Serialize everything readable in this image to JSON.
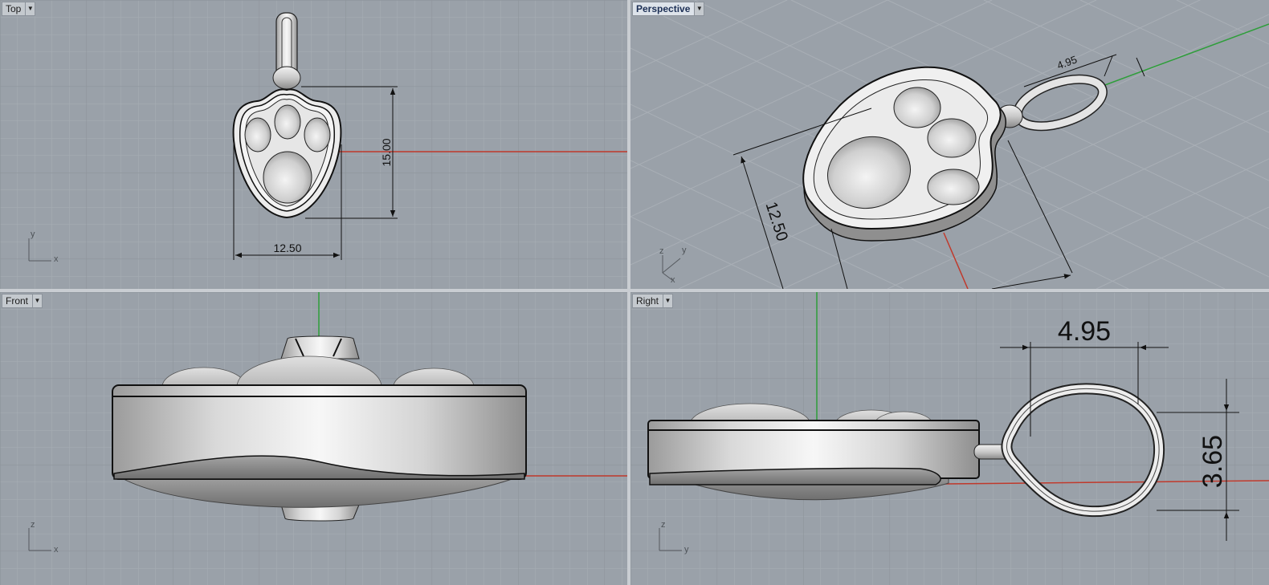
{
  "viewports": {
    "top": {
      "label": "Top",
      "dim_width": "12.50",
      "dim_height": "15.00",
      "axis_v": "y",
      "axis_h": "x"
    },
    "perspective": {
      "label": "Perspective",
      "dim_width": "12.50",
      "dim_ring": "4.95",
      "axis_z": "z",
      "axis_y": "y",
      "axis_x": "x"
    },
    "front": {
      "label": "Front",
      "axis_v": "z",
      "axis_h": "x"
    },
    "right": {
      "label": "Right",
      "dim_ring_width": "4.95",
      "dim_ring_height": "3.65",
      "axis_v": "z",
      "axis_h": "y"
    }
  },
  "colors": {
    "background": "#9aa1a9",
    "grid_minor": "#a7adb4",
    "grid_major": "#8e959c",
    "x_axis": "#c0392b",
    "y_axis": "#2e9e3a",
    "active_tab": "#dde3ea"
  },
  "icons": {
    "viewport_menu": "chevron-down-icon"
  }
}
